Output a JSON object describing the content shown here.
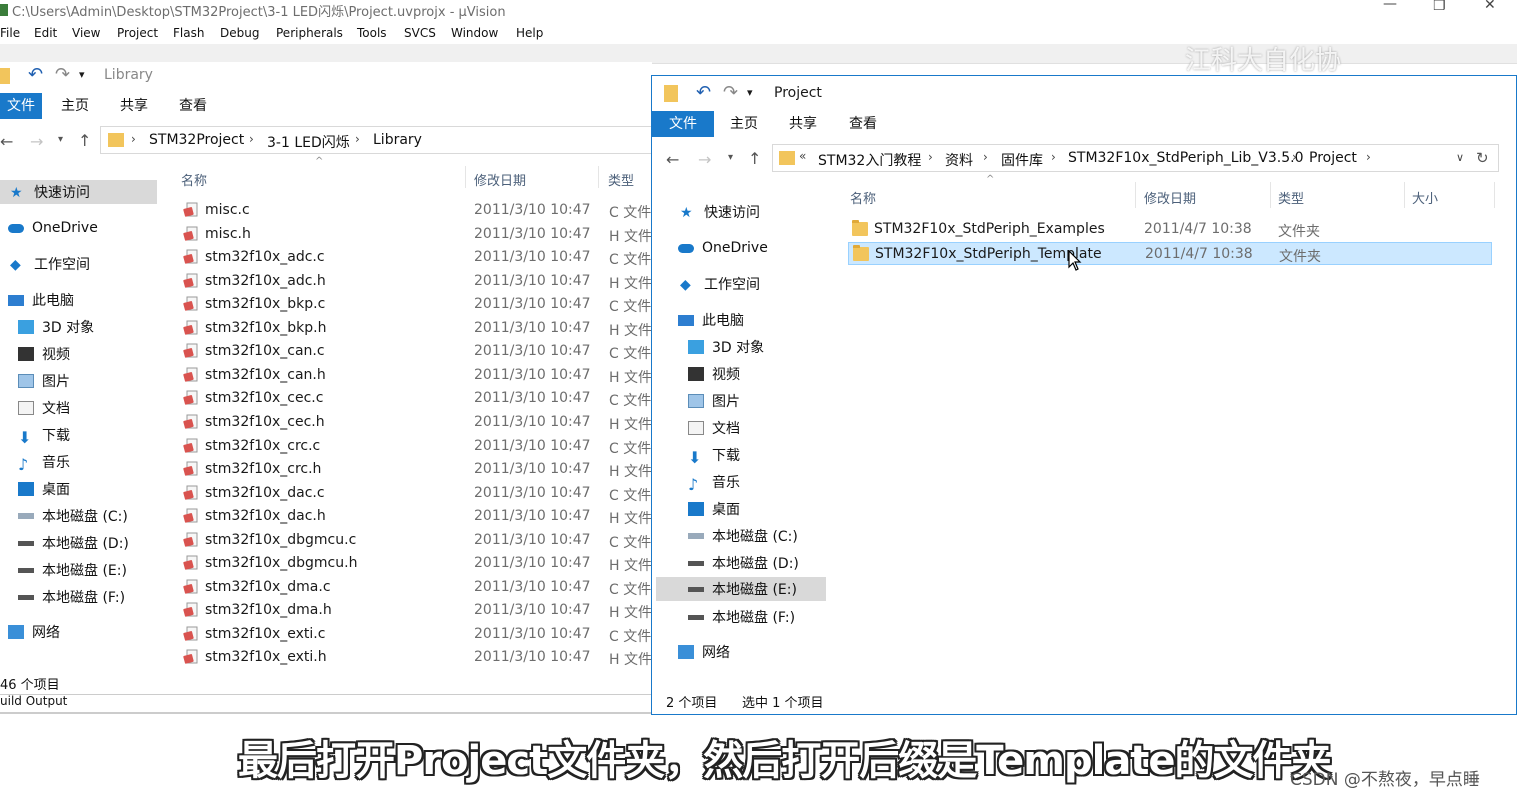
{
  "uvision": {
    "title": "C:\\Users\\Admin\\Desktop\\STM32Project\\3-1 LED闪烁\\Project.uvprojx - µVision",
    "menu": [
      "File",
      "Edit",
      "View",
      "Project",
      "Flash",
      "Debug",
      "Peripherals",
      "Tools",
      "SVCS",
      "Window",
      "Help"
    ],
    "build_output_label": "uild Output"
  },
  "left_explorer": {
    "title": "Library",
    "tabs": [
      "文件",
      "主页",
      "共享",
      "查看"
    ],
    "breadcrumb": [
      "STM32Project",
      "3-1 LED闪烁",
      "Library"
    ],
    "columns": [
      "名称",
      "修改日期",
      "类型"
    ],
    "nav": {
      "quick_access": "快速访问",
      "onedrive": "OneDrive",
      "workspace": "工作空间",
      "this_pc": "此电脑",
      "objects3d": "3D 对象",
      "videos": "视频",
      "pictures": "图片",
      "documents": "文档",
      "downloads": "下载",
      "music": "音乐",
      "desktop": "桌面",
      "disk_c": "本地磁盘 (C:)",
      "disk_d": "本地磁盘 (D:)",
      "disk_e": "本地磁盘 (E:)",
      "disk_f": "本地磁盘 (F:)",
      "network": "网络"
    },
    "files": [
      {
        "name": "misc.c",
        "date": "2011/3/10 10:47",
        "type": "C 文件"
      },
      {
        "name": "misc.h",
        "date": "2011/3/10 10:47",
        "type": "H 文件"
      },
      {
        "name": "stm32f10x_adc.c",
        "date": "2011/3/10 10:47",
        "type": "C 文件"
      },
      {
        "name": "stm32f10x_adc.h",
        "date": "2011/3/10 10:47",
        "type": "H 文件"
      },
      {
        "name": "stm32f10x_bkp.c",
        "date": "2011/3/10 10:47",
        "type": "C 文件"
      },
      {
        "name": "stm32f10x_bkp.h",
        "date": "2011/3/10 10:47",
        "type": "H 文件"
      },
      {
        "name": "stm32f10x_can.c",
        "date": "2011/3/10 10:47",
        "type": "C 文件"
      },
      {
        "name": "stm32f10x_can.h",
        "date": "2011/3/10 10:47",
        "type": "H 文件"
      },
      {
        "name": "stm32f10x_cec.c",
        "date": "2011/3/10 10:47",
        "type": "C 文件"
      },
      {
        "name": "stm32f10x_cec.h",
        "date": "2011/3/10 10:47",
        "type": "H 文件"
      },
      {
        "name": "stm32f10x_crc.c",
        "date": "2011/3/10 10:47",
        "type": "C 文件"
      },
      {
        "name": "stm32f10x_crc.h",
        "date": "2011/3/10 10:47",
        "type": "H 文件"
      },
      {
        "name": "stm32f10x_dac.c",
        "date": "2011/3/10 10:47",
        "type": "C 文件"
      },
      {
        "name": "stm32f10x_dac.h",
        "date": "2011/3/10 10:47",
        "type": "H 文件"
      },
      {
        "name": "stm32f10x_dbgmcu.c",
        "date": "2011/3/10 10:47",
        "type": "C 文件"
      },
      {
        "name": "stm32f10x_dbgmcu.h",
        "date": "2011/3/10 10:47",
        "type": "H 文件"
      },
      {
        "name": "stm32f10x_dma.c",
        "date": "2011/3/10 10:47",
        "type": "C 文件"
      },
      {
        "name": "stm32f10x_dma.h",
        "date": "2011/3/10 10:47",
        "type": "H 文件"
      },
      {
        "name": "stm32f10x_exti.c",
        "date": "2011/3/10 10:47",
        "type": "C 文件"
      },
      {
        "name": "stm32f10x_exti.h",
        "date": "2011/3/10 10:47",
        "type": "H 文件"
      }
    ],
    "status": "46 个项目"
  },
  "right_explorer": {
    "title": "Project",
    "tabs": [
      "文件",
      "主页",
      "共享",
      "查看"
    ],
    "breadcrumb_prefix": "«",
    "breadcrumb": [
      "STM32入门教程",
      "资料",
      "固件库",
      "STM32F10x_StdPeriph_Lib_V3.5.0",
      "Project"
    ],
    "columns": [
      "名称",
      "修改日期",
      "类型",
      "大小"
    ],
    "nav": {
      "quick_access": "快速访问",
      "onedrive": "OneDrive",
      "workspace": "工作空间",
      "this_pc": "此电脑",
      "objects3d": "3D 对象",
      "videos": "视频",
      "pictures": "图片",
      "documents": "文档",
      "downloads": "下载",
      "music": "音乐",
      "desktop": "桌面",
      "disk_c": "本地磁盘 (C:)",
      "disk_d": "本地磁盘 (D:)",
      "disk_e": "本地磁盘 (E:)",
      "disk_f": "本地磁盘 (F:)",
      "network": "网络"
    },
    "folders": [
      {
        "name": "STM32F10x_StdPeriph_Examples",
        "date": "2011/4/7 10:38",
        "type": "文件夹",
        "selected": false
      },
      {
        "name": "STM32F10x_StdPeriph_Template",
        "date": "2011/4/7 10:38",
        "type": "文件夹",
        "selected": true
      }
    ],
    "status_count": "2 个项目",
    "status_selected": "选中 1 个项目"
  },
  "subtitle": "最后打开Project文件夹，然后打开后缀是Template的文件夹",
  "watermark": "CSDN @不熬夜，早点睡",
  "corner_watermark": "江科大自化协",
  "colors": {
    "accent": "#1979ca",
    "selection": "#cce8ff",
    "folder": "#f2c55c"
  }
}
